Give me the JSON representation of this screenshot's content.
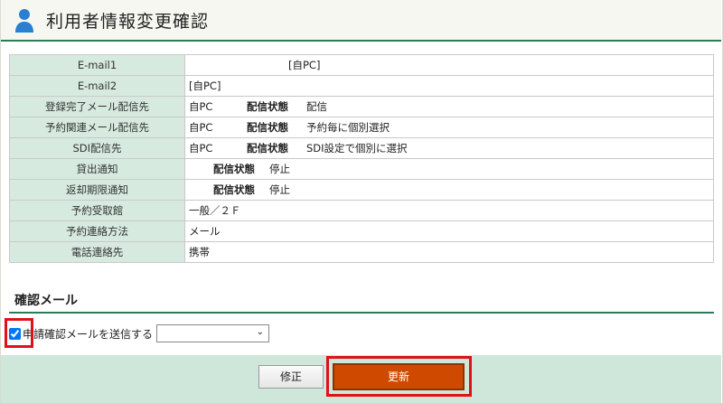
{
  "header": {
    "title": "利用者情報変更確認",
    "icon": "user-icon"
  },
  "info_rows": [
    {
      "label": "E-mail1",
      "value": "[自PC]"
    },
    {
      "label": "E-mail2",
      "value": "[自PC]"
    },
    {
      "label": "登録完了メール配信先",
      "dest": "自PC",
      "status_label": "配信状態",
      "status": "配信"
    },
    {
      "label": "予約関連メール配信先",
      "dest": "自PC",
      "status_label": "配信状態",
      "status": "予約毎に個別選択"
    },
    {
      "label": "SDI配信先",
      "dest": "自PC",
      "status_label": "配信状態",
      "status": "SDI設定で個別に選択"
    },
    {
      "label": "貸出通知",
      "status_label": "配信状態",
      "status": "停止"
    },
    {
      "label": "返却期限通知",
      "status_label": "配信状態",
      "status": "停止"
    },
    {
      "label": "予約受取館",
      "value": "一般／２Ｆ"
    },
    {
      "label": "予約連絡方法",
      "value": "メール"
    },
    {
      "label": "電話連絡先",
      "value": "携帯"
    }
  ],
  "confirm_mail": {
    "section_title": "確認メール",
    "checkbox_label": "申請確認メールを送信する",
    "checked": true,
    "select_value": ""
  },
  "buttons": {
    "correct": "修正",
    "update": "更新"
  },
  "colors": {
    "accent": "#2d7a56",
    "label_bg": "#d7eae0",
    "update_btn": "#cf4a00",
    "highlight": "#e0101a"
  }
}
